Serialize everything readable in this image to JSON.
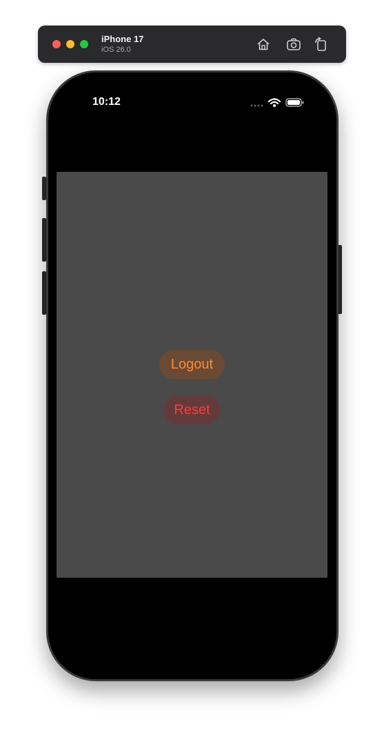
{
  "window": {
    "device_name": "iPhone 17",
    "os_version": "iOS 26.0",
    "toolbar_icons": [
      "home-icon",
      "screenshot-icon",
      "rotate-icon"
    ]
  },
  "status_bar": {
    "time": "10:12",
    "icons": [
      "cellular-signal-icon",
      "wifi-icon",
      "battery-icon"
    ]
  },
  "main": {
    "logout_label": "Logout",
    "reset_label": "Reset"
  },
  "colors": {
    "logout_text": "#ff8a2a",
    "reset_text": "#ff3b3b",
    "content_bg": "#4a4a4a"
  }
}
